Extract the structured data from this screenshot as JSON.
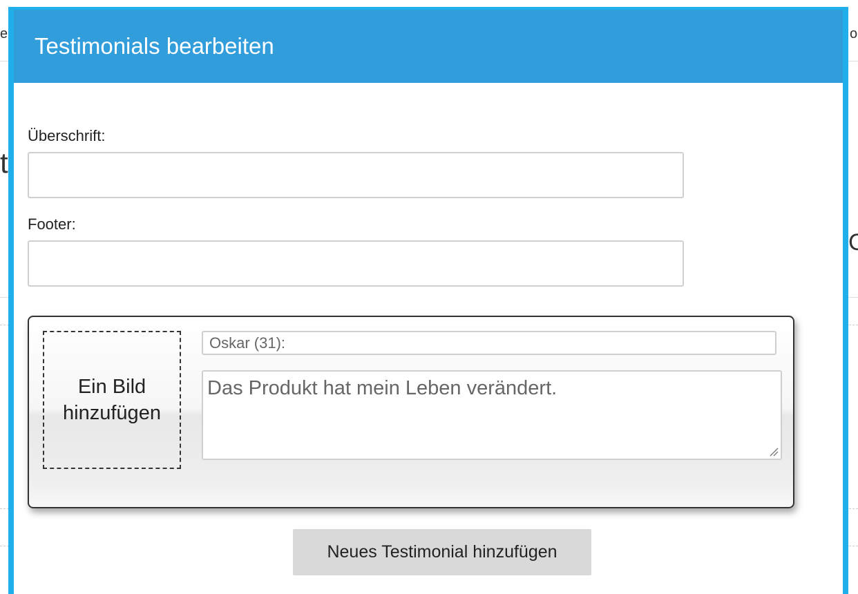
{
  "background": {
    "fragment_top_left": "ei",
    "fragment_top_right": "o",
    "fragment_mid_left": "t",
    "fragment_mid_right": "C"
  },
  "modal": {
    "title": "Testimonials bearbeiten",
    "header_color": "#329ddb",
    "border_color": "#1fb0ec"
  },
  "form": {
    "heading_label": "Überschrift:",
    "heading_value": "",
    "footer_label": "Footer:",
    "footer_value": ""
  },
  "testimonial": {
    "image_placeholder": "Ein Bild hinzufügen",
    "name_value": "Oskar (31):",
    "quote_value": "Das Produkt hat mein Leben verändert."
  },
  "actions": {
    "add_label": "Neues Testimonial hinzufügen"
  }
}
